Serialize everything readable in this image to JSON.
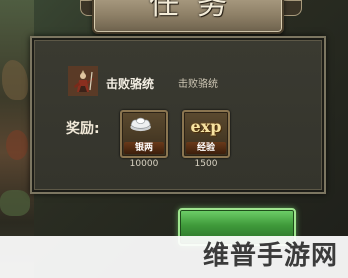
{
  "window": {
    "title": "任务"
  },
  "task": {
    "name": "击败骆统",
    "description": "击败骆统",
    "icon": "warrior-portrait-icon"
  },
  "rewards": {
    "label": "奖励:",
    "items": [
      {
        "name": "银两",
        "amount": "10000",
        "icon": "silver-ingot-icon"
      },
      {
        "name": "经验",
        "badge": "exp",
        "amount": "1500",
        "icon": "exp-icon"
      }
    ]
  },
  "watermark": {
    "text": "维普手游网"
  },
  "colors": {
    "accept_button": "#3f9a3a",
    "panel_border": "#7c7661",
    "title_text": "#f3ecd8"
  }
}
